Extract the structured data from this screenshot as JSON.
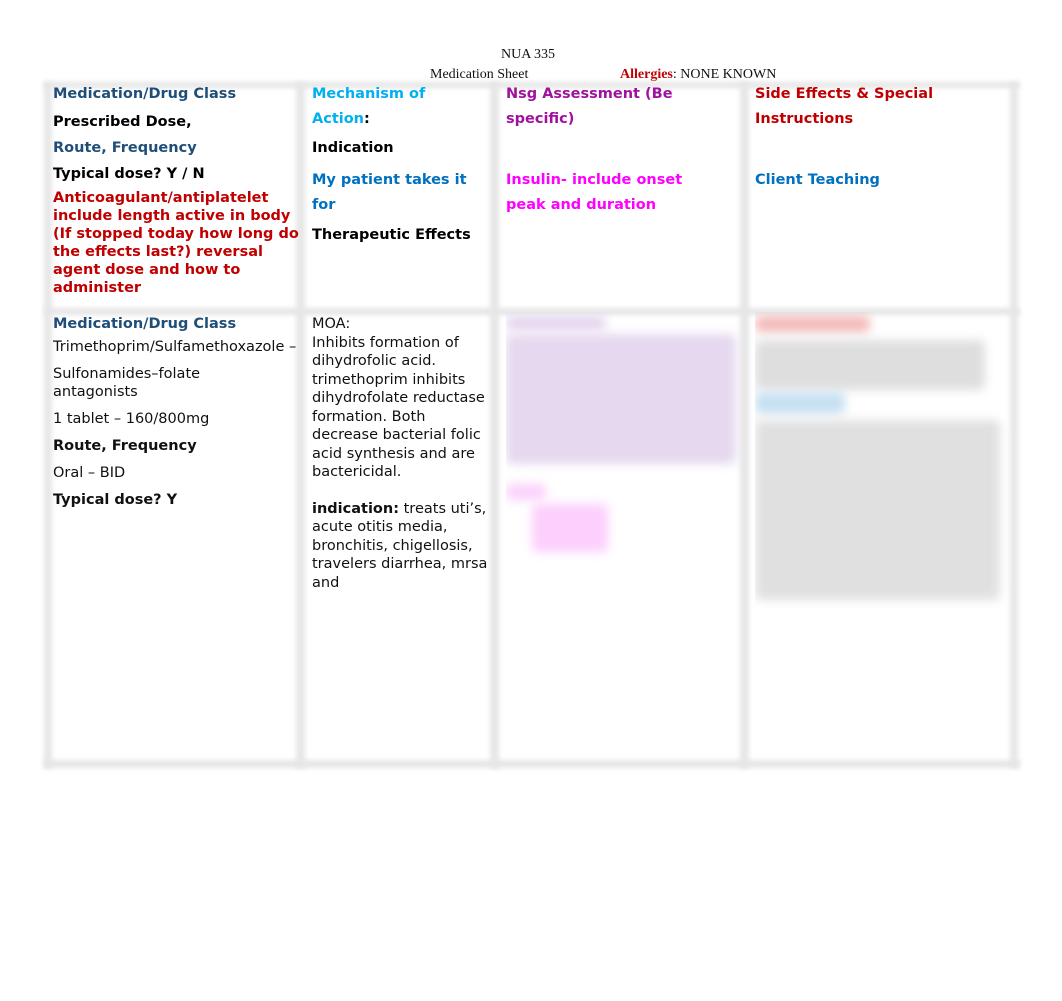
{
  "document": {
    "course_code": "NUA 335",
    "title": "Medication Sheet",
    "allergies_label": "Allergies",
    "allergies_separator": ": ",
    "allergies_value": "NONE KNOWN"
  },
  "colors": {
    "navy": "#1f4e79",
    "cyan": "#00b0f0",
    "blue": "#0070c0",
    "purple": "#a0119e",
    "magenta": "#ff00ff",
    "red": "#c00000"
  },
  "header_row": {
    "col1": {
      "title": "Medication/Drug Class",
      "prescribed_dose": "Prescribed Dose,",
      "route_frequency": "Route, Frequency",
      "typical_dose": "Typical dose? Y / N",
      "anticoagulant_note": "Anticoagulant/antiplatelet include length active in body (If stopped today how long do the effects last?)  reversal agent dose and how to administer"
    },
    "col2": {
      "title_part1": "Mechanism of",
      "title_part2": "Action",
      "title_colon": ":",
      "indication": "Indication",
      "my_patient_line1": "My patient takes it",
      "my_patient_line2": "for",
      "therapeutic_effects": "Therapeutic Effects"
    },
    "col3": {
      "title_line1": "Nsg Assessment (Be",
      "title_line2": "specific)",
      "insulin_line1": "Insulin- include onset",
      "insulin_line2": "peak and duration"
    },
    "col4": {
      "title_line1": "Side Effects & Special",
      "title_line2": "Instructions",
      "client_teaching": "Client Teaching"
    }
  },
  "medication_row": {
    "col1": {
      "title": "Medication/Drug Class",
      "drug_name": "Trimethoprim/Sulfamethoxazole –",
      "drug_class": "Sulfonamides–folate antagonists",
      "dose": "1 tablet – 160/800mg",
      "route_label": "Route, Frequency",
      "route_value": "Oral – BID",
      "typical_dose": "Typical dose? Y"
    },
    "col2": {
      "moa_label": "MOA:",
      "moa_text": "Inhibits formation of dihydrofolic acid. trimethoprim inhibits dihydrofolate reductase formation. Both decrease bacterial folic acid synthesis and are bactericidal.",
      "indication_label": "indication:",
      "indication_text": " treats uti’s, acute otitis media, bronchitis, chigellosis, travelers diarrhea, mrsa and"
    },
    "col3": {
      "content_state": "blurred"
    },
    "col4": {
      "content_state": "blurred"
    }
  }
}
